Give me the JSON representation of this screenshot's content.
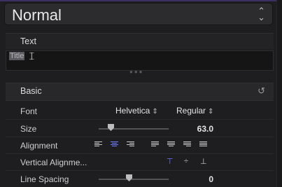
{
  "preset": {
    "label": "Normal"
  },
  "text_section": {
    "label": "Text",
    "field_value": "Title"
  },
  "basic_section": {
    "label": "Basic"
  },
  "rows": {
    "font": {
      "label": "Font",
      "family": "Helvetica",
      "weight": "Regular"
    },
    "size": {
      "label": "Size",
      "value": "63.0",
      "slider_level": 0.25
    },
    "alignment": {
      "label": "Alignment",
      "selected": "center"
    },
    "vertical_alignment": {
      "label": "Vertical Alignme...",
      "selected": "top"
    },
    "line_spacing": {
      "label": "Line Spacing",
      "value": "0",
      "slider_level": 0.5
    }
  },
  "colors": {
    "accent": "#6b7bff",
    "background": "#1e1e20"
  }
}
